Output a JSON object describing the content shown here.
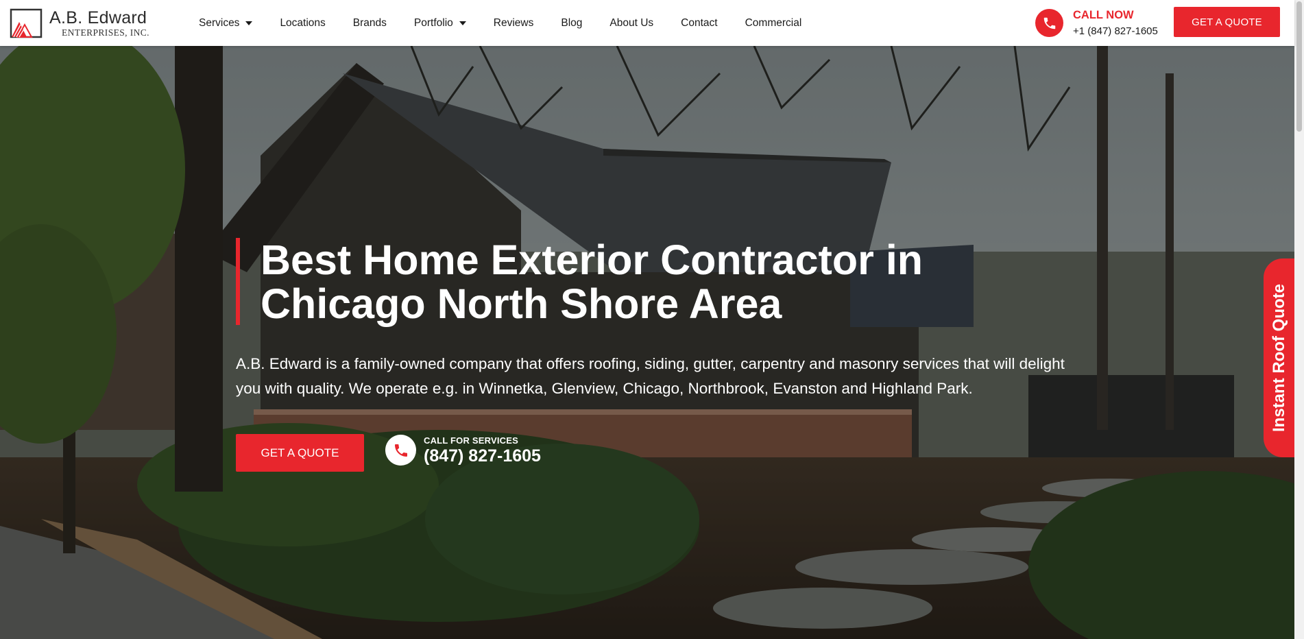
{
  "brand": {
    "name": "A.B. Edward",
    "subtitle": "ENTERPRISES, INC.",
    "accent_color": "#e8262d"
  },
  "nav": {
    "items": [
      {
        "label": "Services",
        "has_dropdown": true
      },
      {
        "label": "Locations",
        "has_dropdown": false
      },
      {
        "label": "Brands",
        "has_dropdown": false
      },
      {
        "label": "Portfolio",
        "has_dropdown": true
      },
      {
        "label": "Reviews",
        "has_dropdown": false
      },
      {
        "label": "Blog",
        "has_dropdown": false
      },
      {
        "label": "About Us",
        "has_dropdown": false
      },
      {
        "label": "Contact",
        "has_dropdown": false
      },
      {
        "label": "Commercial",
        "has_dropdown": false
      }
    ]
  },
  "header": {
    "call_title": "CALL NOW",
    "call_number": "+1 (847) 827-1605",
    "cta_label": "GET A QUOTE",
    "phone_icon": "phone-icon"
  },
  "hero": {
    "title": "Best Home Exterior Contractor in Chicago North Shore Area",
    "description": "A.B. Edward is a family-owned company that offers roofing, siding, gutter, carpentry and masonry services that will delight you with quality. We operate e.g. in Winnetka, Glenview, Chicago, Northbrook, Evanston and Highland Park.",
    "cta_label": "GET A QUOTE",
    "call_label": "CALL FOR SERVICES",
    "call_number": "(847) 827-1605"
  },
  "side_tab": {
    "label": "Instant Roof Quote"
  }
}
